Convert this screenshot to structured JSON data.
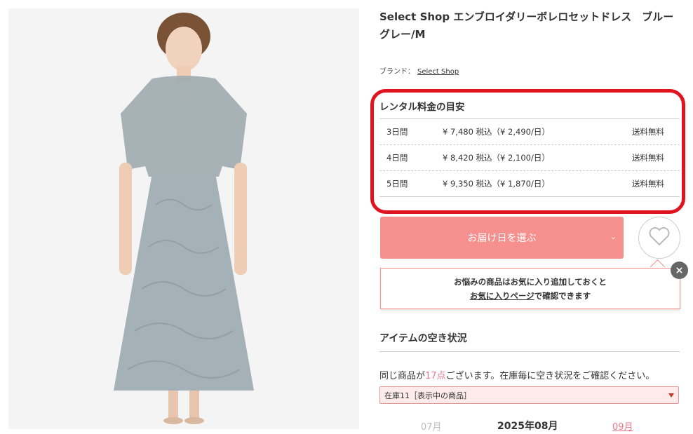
{
  "product": {
    "title": "Select Shop エンブロイダリーボレロセットドレス　ブルーグレー/M",
    "brand_label": "ブランド：",
    "brand_name": "Select Shop"
  },
  "rental": {
    "title": "レンタル料金の目安",
    "rows": [
      {
        "days": "3日間",
        "price": "¥ 7,480",
        "tax": "税込（¥ 2,490/日）",
        "shipping": "送料無料"
      },
      {
        "days": "4日間",
        "price": "¥ 8,420",
        "tax": "税込（¥ 2,100/日）",
        "shipping": "送料無料"
      },
      {
        "days": "5日間",
        "price": "¥ 9,350",
        "tax": "税込（¥ 1,870/日）",
        "shipping": "送料無料"
      }
    ],
    "highlight_color": "#e0141f"
  },
  "cta": {
    "label": "お届け日を選ぶ",
    "color": "#f5908f"
  },
  "tooltip": {
    "line1": "お悩みの商品はお気に入り追加しておくと",
    "link": "お気に入りページ",
    "line2_rest": "で確認できます"
  },
  "availability": {
    "title": "アイテムの空き状況",
    "stock_prefix": "同じ商品が",
    "stock_count": "17点",
    "stock_suffix": "ございます。在庫毎に空き状況をご確認ください。",
    "select_value": "在庫11［表示中の商品］"
  },
  "calendar": {
    "prev_month": "07月",
    "current_month": "2025年08月",
    "next_month": "09月"
  },
  "icons": {
    "favorite": "heart-icon",
    "close": "close-icon",
    "dropdown": "chevron-down-icon"
  }
}
